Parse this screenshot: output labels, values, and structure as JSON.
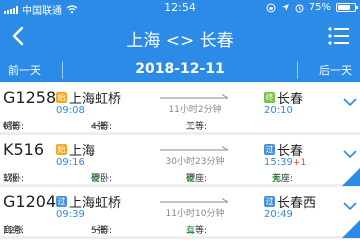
{
  "status": {
    "carrier": "中国联通",
    "time": "12:54",
    "battery": "75%",
    "battery_level": 0.75
  },
  "nav": {
    "title": "上海 <> 长春"
  },
  "datebar": {
    "prev": "前一天",
    "date": "2018-12-11",
    "next": "后一天"
  },
  "trains": [
    {
      "no": "G1258",
      "from_badge": "始",
      "from": "上海虹桥",
      "depart": "09:08",
      "duration": "11小时2分钟",
      "to_badge": "终",
      "to": "长春",
      "arrive": "20:10",
      "arrive_extra": "",
      "seats": [
        {
          "label": "特等: ",
          "value": "6张"
        },
        {
          "label": "一等: ",
          "value": "4张"
        },
        {
          "label": "二等: ",
          "value": "无"
        }
      ]
    },
    {
      "no": "K516",
      "from_badge": "始",
      "from": "上海",
      "depart": "09:16",
      "duration": "30小时23分钟",
      "to_badge": "过",
      "to": "长春",
      "arrive": "15:39",
      "arrive_extra": "+1",
      "seats": [
        {
          "label": "软卧: ",
          "value": "1张"
        },
        {
          "label": "硬卧: ",
          "value": "有"
        },
        {
          "label": "硬座: ",
          "value": "有"
        },
        {
          "label": "无座: ",
          "value": "有"
        }
      ]
    },
    {
      "no": "G1204",
      "from_badge": "过",
      "from": "上海虹桥",
      "depart": "09:39",
      "duration": "11小时10分钟",
      "to_badge": "过",
      "to": "长春西",
      "arrive": "20:49",
      "arrive_extra": "",
      "seats": [
        {
          "label": "商务: ",
          "value": "12张"
        },
        {
          "label": "一等: ",
          "value": "5张"
        },
        {
          "label": "二等: ",
          "value": "有"
        }
      ]
    }
  ],
  "colors": {
    "brand": "#2b8be6",
    "available": "#2e9e3a",
    "badge_origin": "#f5a623",
    "badge_terminal": "#7ac143",
    "badge_pass": "#4a90d9"
  }
}
